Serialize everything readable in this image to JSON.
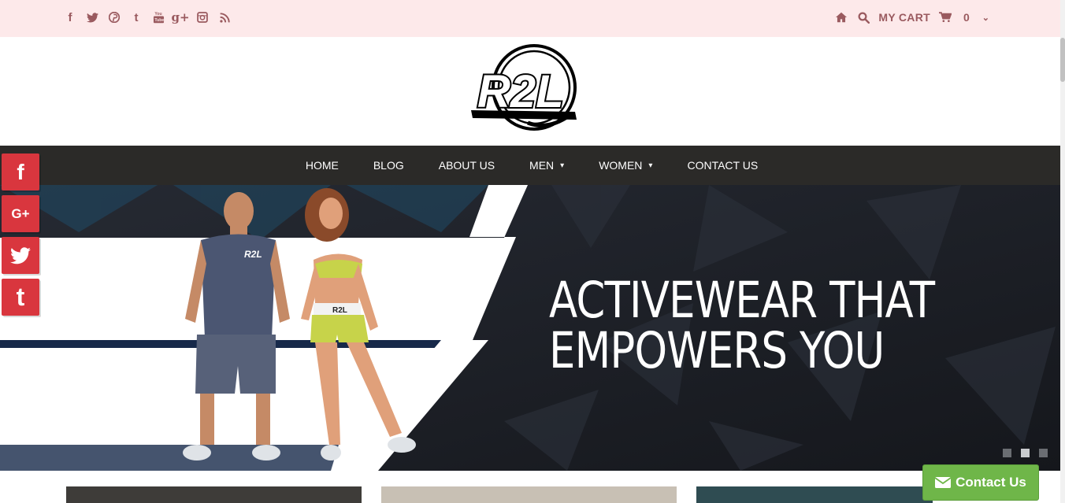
{
  "topbar": {
    "social_icons": [
      "facebook-icon",
      "twitter-icon",
      "pinterest-icon",
      "tumblr-icon",
      "youtube-icon",
      "google-plus-icon",
      "instagram-icon",
      "rss-icon"
    ],
    "social_glyphs": [
      "f",
      "t",
      "P",
      "t",
      "▶",
      "g+",
      "◘",
      "⌇"
    ],
    "cart_label": "MY CART",
    "cart_count": "0",
    "accent_color": "#9a5a5f",
    "background": "#fde9ea"
  },
  "logo": {
    "text": "R2L"
  },
  "nav": {
    "items": [
      {
        "label": "HOME"
      },
      {
        "label": "BLOG"
      },
      {
        "label": "ABOUT US"
      },
      {
        "label": "MEN",
        "dropdown": true
      },
      {
        "label": "WOMEN",
        "dropdown": true
      },
      {
        "label": "CONTACT US"
      }
    ]
  },
  "hero": {
    "line1": "ACTIVEWEAR THAT",
    "line2": "EMPOWERS YOU",
    "model_logo": "R2L",
    "slides": 3,
    "active_slide": 2
  },
  "side_social": [
    {
      "name": "facebook",
      "glyph": "f"
    },
    {
      "name": "google-plus",
      "glyph": "G+"
    },
    {
      "name": "twitter",
      "glyph": "🐦"
    },
    {
      "name": "tumblr",
      "glyph": "t"
    }
  ],
  "contact_button": {
    "label": "Contact Us",
    "color": "#6fb649"
  }
}
